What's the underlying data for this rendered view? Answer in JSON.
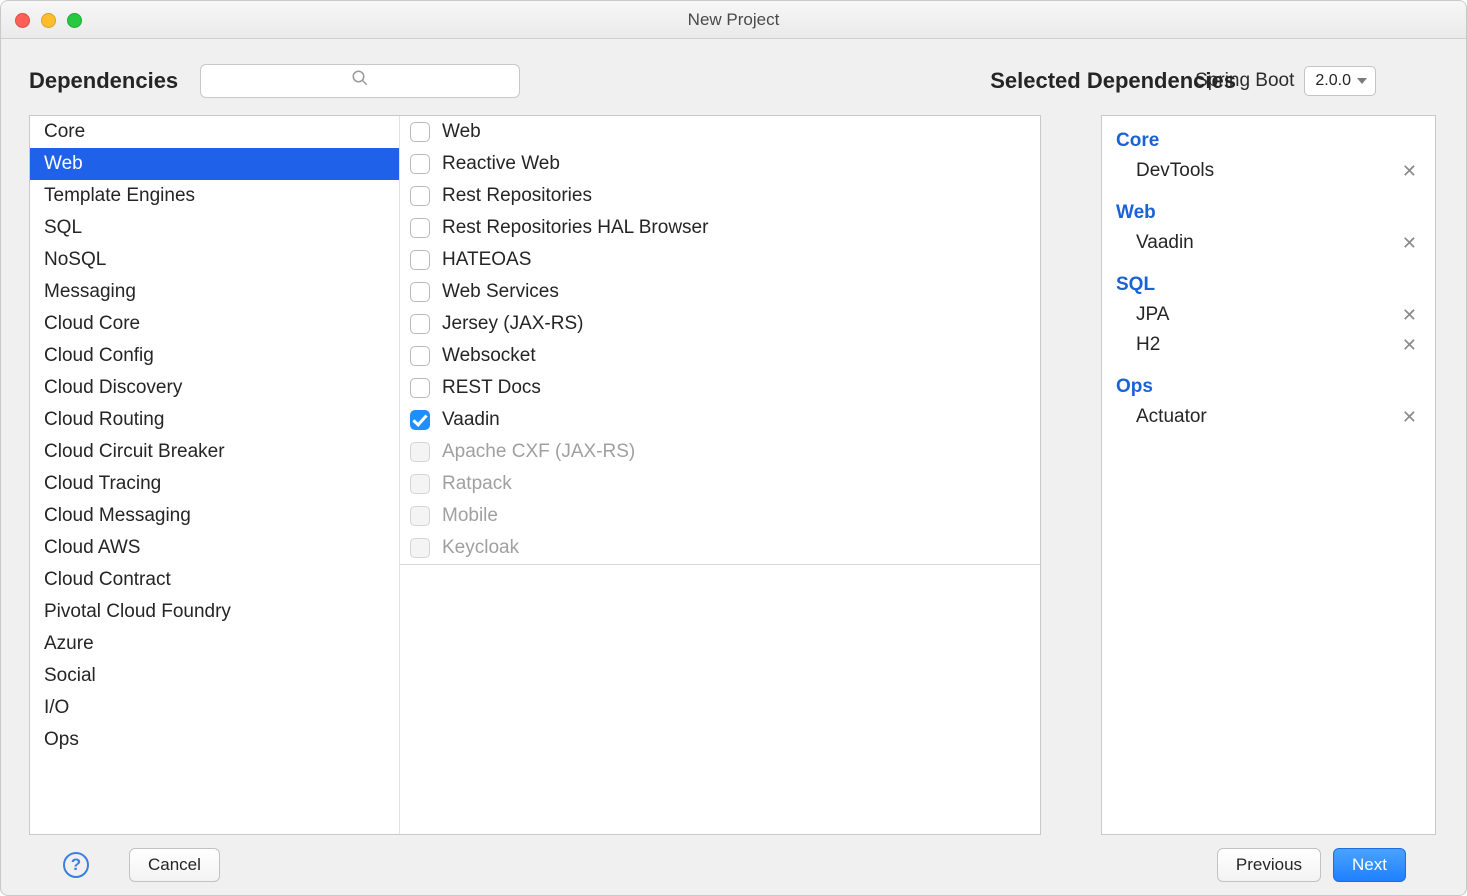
{
  "window": {
    "title": "New Project"
  },
  "header": {
    "dependencies_label": "Dependencies",
    "search_placeholder": "",
    "springboot_label": "Spring Boot",
    "springboot_version": "2.0.0",
    "selected_label": "Selected Dependencies"
  },
  "categories": [
    {
      "label": "Core",
      "selected": false
    },
    {
      "label": "Web",
      "selected": true
    },
    {
      "label": "Template Engines",
      "selected": false
    },
    {
      "label": "SQL",
      "selected": false
    },
    {
      "label": "NoSQL",
      "selected": false
    },
    {
      "label": "Messaging",
      "selected": false
    },
    {
      "label": "Cloud Core",
      "selected": false
    },
    {
      "label": "Cloud Config",
      "selected": false
    },
    {
      "label": "Cloud Discovery",
      "selected": false
    },
    {
      "label": "Cloud Routing",
      "selected": false
    },
    {
      "label": "Cloud Circuit Breaker",
      "selected": false
    },
    {
      "label": "Cloud Tracing",
      "selected": false
    },
    {
      "label": "Cloud Messaging",
      "selected": false
    },
    {
      "label": "Cloud AWS",
      "selected": false
    },
    {
      "label": "Cloud Contract",
      "selected": false
    },
    {
      "label": "Pivotal Cloud Foundry",
      "selected": false
    },
    {
      "label": "Azure",
      "selected": false
    },
    {
      "label": "Social",
      "selected": false
    },
    {
      "label": "I/O",
      "selected": false
    },
    {
      "label": "Ops",
      "selected": false
    }
  ],
  "dependencies": [
    {
      "label": "Web",
      "checked": false,
      "disabled": false
    },
    {
      "label": "Reactive Web",
      "checked": false,
      "disabled": false
    },
    {
      "label": "Rest Repositories",
      "checked": false,
      "disabled": false
    },
    {
      "label": "Rest Repositories HAL Browser",
      "checked": false,
      "disabled": false
    },
    {
      "label": "HATEOAS",
      "checked": false,
      "disabled": false
    },
    {
      "label": "Web Services",
      "checked": false,
      "disabled": false
    },
    {
      "label": "Jersey (JAX-RS)",
      "checked": false,
      "disabled": false
    },
    {
      "label": "Websocket",
      "checked": false,
      "disabled": false
    },
    {
      "label": "REST Docs",
      "checked": false,
      "disabled": false
    },
    {
      "label": "Vaadin",
      "checked": true,
      "disabled": false
    },
    {
      "label": "Apache CXF (JAX-RS)",
      "checked": false,
      "disabled": true
    },
    {
      "label": "Ratpack",
      "checked": false,
      "disabled": true
    },
    {
      "label": "Mobile",
      "checked": false,
      "disabled": true
    },
    {
      "label": "Keycloak",
      "checked": false,
      "disabled": true
    }
  ],
  "selected": [
    {
      "group": "Core",
      "items": [
        "DevTools"
      ]
    },
    {
      "group": "Web",
      "items": [
        "Vaadin"
      ]
    },
    {
      "group": "SQL",
      "items": [
        "JPA",
        "H2"
      ]
    },
    {
      "group": "Ops",
      "items": [
        "Actuator"
      ]
    }
  ],
  "footer": {
    "help": "?",
    "cancel": "Cancel",
    "previous": "Previous",
    "next": "Next"
  }
}
